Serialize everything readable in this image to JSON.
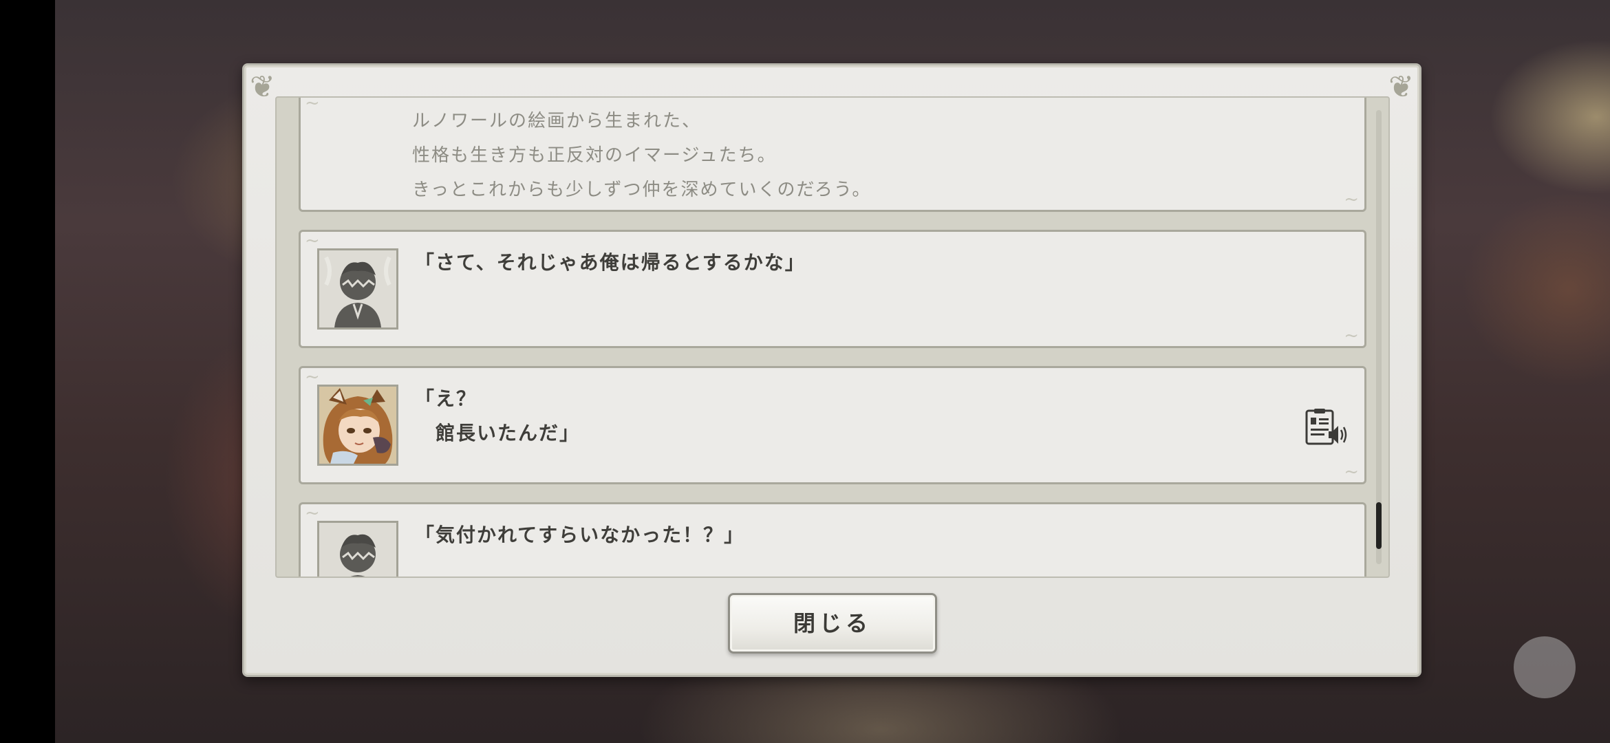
{
  "log": {
    "narration": {
      "lines": [
        "ルノワールの絵画から生まれた、",
        "性格も生き方も正反対のイマージュたち。",
        "きっとこれからも少しずつ仲を深めていくのだろう。"
      ]
    },
    "entries": [
      {
        "portrait": "player-silhouette-icon",
        "lines": [
          "「さて、それじゃあ俺は帰るとするかな」"
        ]
      },
      {
        "portrait": "character-portrait",
        "lines": [
          "「え？",
          "　館長いたんだ」"
        ],
        "voice_icon": "voice-replay-icon"
      },
      {
        "portrait": "player-silhouette-icon",
        "lines": [
          "「気付かれてすらいなかった！？」"
        ]
      }
    ]
  },
  "close_button": {
    "label": "閉じる"
  },
  "colors": {
    "panel": "#ecebe8",
    "border": "#a9a89c",
    "narration_text": "#8d8c84",
    "speech_text": "#3f3e3a"
  }
}
